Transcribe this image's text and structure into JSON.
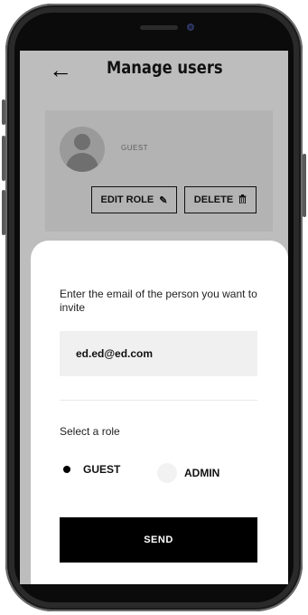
{
  "header": {
    "back_icon": "arrow-left-icon",
    "title": "Manage users"
  },
  "user_card": {
    "role": "GUEST",
    "edit_label": "EDIT ROLE",
    "edit_icon": "pencil-icon",
    "delete_label": "DELETE",
    "delete_icon": "trash-icon"
  },
  "invite": {
    "prompt": "Enter the email of the person you want to invite",
    "email_value": "ed.ed@ed.com",
    "role_prompt": "Select a role",
    "roles": [
      "GUEST",
      "ADMIN"
    ],
    "selected_role": "GUEST",
    "send_label": "SEND"
  },
  "colors": {
    "overlay": "#bdbdbd",
    "card": "#b3b3b3",
    "primary": "#000000",
    "field": "#f0f0f0"
  }
}
